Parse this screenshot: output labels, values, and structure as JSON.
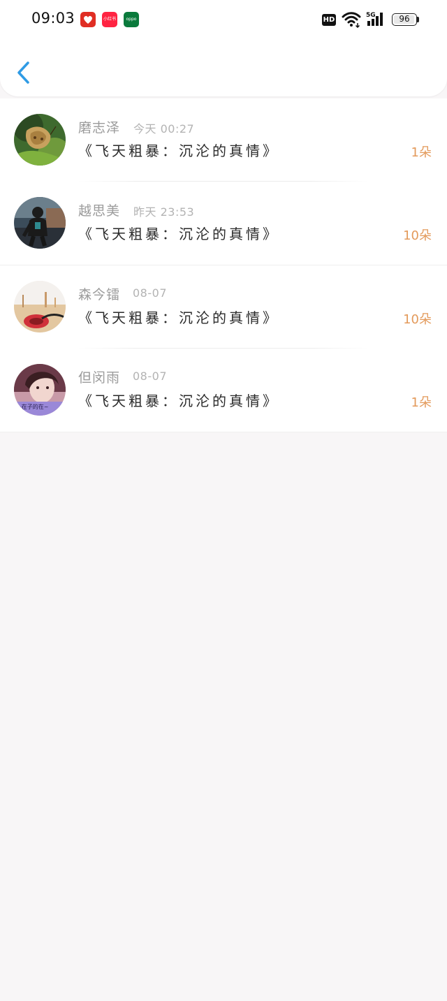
{
  "status_bar": {
    "time": "09:03",
    "apps": [
      {
        "name": "pinduoduo-icon",
        "label": "拼",
        "color": "#e02e24"
      },
      {
        "name": "xiaohongshu-icon",
        "label": "小红书",
        "color": "#ff2442"
      },
      {
        "name": "oppo-icon",
        "label": "oppo",
        "color": "#0a7a3c"
      }
    ],
    "hd": "HD",
    "network": "5G",
    "battery": "96",
    "battery_level": 0.96
  },
  "header": {
    "back_icon": "chevron-left-icon",
    "accent_color": "#2f9be5"
  },
  "items": [
    {
      "name": "磨志泽",
      "date": "今天 00:27",
      "title": "《飞天粗暴：沉沦的真情》",
      "count": "1朵"
    },
    {
      "name": "越思美",
      "date": "昨天 23:53",
      "title": "《飞天粗暴：沉沦的真情》",
      "count": "10朵"
    },
    {
      "name": "森今镭",
      "date": "08-07",
      "title": "《飞天粗暴：沉沦的真情》",
      "count": "10朵"
    },
    {
      "name": "但闵雨",
      "date": "08-07",
      "title": "《飞天粗暴：沉沦的真情》",
      "count": "1朵"
    }
  ],
  "colors": {
    "count": "#e39a5b",
    "background": "#f8f6f7"
  }
}
